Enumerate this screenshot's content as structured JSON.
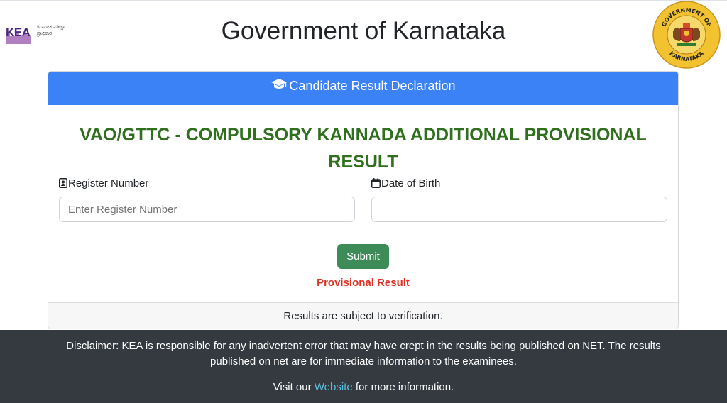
{
  "header": {
    "logo_text": "KEA",
    "logo_subtext": "ಕರ್ನಾಟಕ ಪರೀಕ್ಷಾ ಪ್ರಾಧಿಕಾರ",
    "title": "Government of Karnataka",
    "emblem_top_text": "GOVERNMENT OF",
    "emblem_bottom_text": "KARNATAKA"
  },
  "card": {
    "header_title": "Candidate Result Declaration",
    "header_icon": "graduation-cap-icon",
    "result_title": "VAO/GTTC - COMPULSORY KANNADA ADDITIONAL PROVISIONAL RESULT",
    "register_label": "Register Number",
    "register_icon": "id-card-icon",
    "register_placeholder": "Enter Register Number",
    "register_value": "",
    "dob_label": "Date of Birth",
    "dob_icon": "calendar-icon",
    "dob_value": "",
    "submit_label": "Submit",
    "provisional_label": "Provisional Result",
    "footer_text": "Results are subject to verification."
  },
  "disclaimer": {
    "text": "Disclaimer: KEA is responsible for any inadvertent error that may have crept in the results being published on NET. The results published on net are for immediate information to the examinees.",
    "visit_prefix": "Visit our",
    "visit_link": "Website",
    "visit_suffix": "for more information."
  },
  "colors": {
    "header_blue": "#3b82f6",
    "title_green": "#2f6f1e",
    "submit_green": "#3d8b57",
    "provisional_red": "#dc3226",
    "footer_dark": "#343a40",
    "link_blue": "#5bc0de"
  }
}
